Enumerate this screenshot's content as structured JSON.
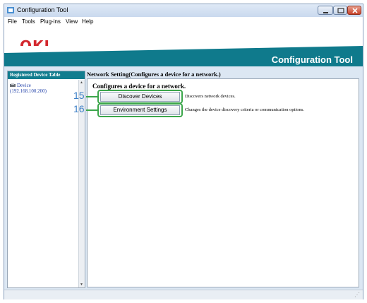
{
  "window": {
    "title": "Configuration Tool"
  },
  "menu": [
    "File",
    "Tools",
    "Plug-ins",
    "View",
    "Help"
  ],
  "banner": {
    "logo": "OKI",
    "title": "Configuration Tool"
  },
  "sidebar": {
    "header": "Registered Device Table",
    "device": {
      "name": "Device",
      "address": "(192.168.100.200)"
    }
  },
  "content": {
    "header": "Network Setting(Configures a device for a network.)",
    "heading": "Configures a device for a network.",
    "actions": [
      {
        "callout": "15",
        "label": "Discover Devices",
        "description": "Discovers network devices."
      },
      {
        "callout": "16",
        "label": "Environment Settings",
        "description": "Changes the device discovery criteria or communication options."
      }
    ]
  },
  "colors": {
    "brand_red": "#d3282e",
    "teal": "#0f7a8c",
    "highlight_green": "#3ba64a",
    "callout_blue": "#3a7ec6"
  }
}
